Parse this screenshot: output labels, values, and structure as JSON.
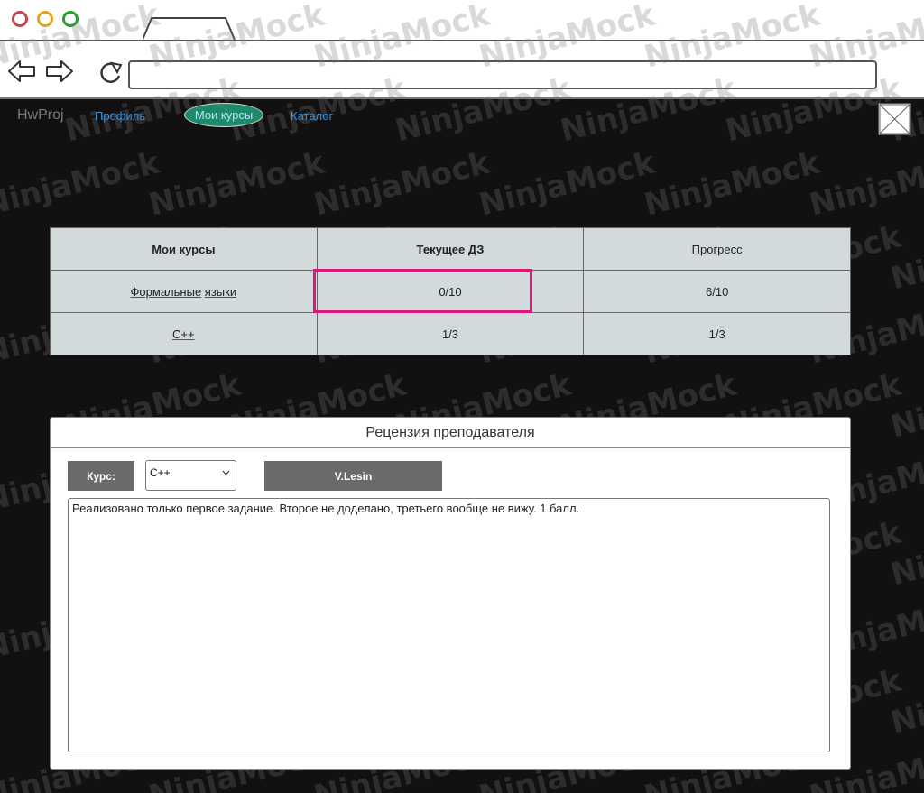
{
  "app": {
    "brand": "HwProj",
    "nav": {
      "profile": "Профиль",
      "my_courses": "Мои курсы",
      "catalog": "Каталог"
    }
  },
  "watermark": {
    "text": "NinjaMock"
  },
  "courses_table": {
    "headers": [
      "Мои курсы",
      "Текущее ДЗ",
      "Прогресс"
    ],
    "rows": [
      {
        "course_word1": "Формальные",
        "course_word2": "языки",
        "current_hw": "0/10",
        "progress": "6/10"
      },
      {
        "course_word1": "C++",
        "course_word2": "",
        "current_hw": "1/3",
        "progress": "1/3"
      }
    ],
    "highlight_color": "#e0157a"
  },
  "review": {
    "title": "Рецензия преподавателя",
    "course_label": "Курс:",
    "course_select_value": "C++",
    "reviewer": "V.Lesin",
    "text": "Реализовано только первое задание. Второе не доделано, третьего вообще не вижу. 1 балл."
  },
  "colors": {
    "background": "#121010",
    "active_nav": "#1f8a6a",
    "link": "#3a8fd6",
    "table_bg": "#d3dadb"
  }
}
